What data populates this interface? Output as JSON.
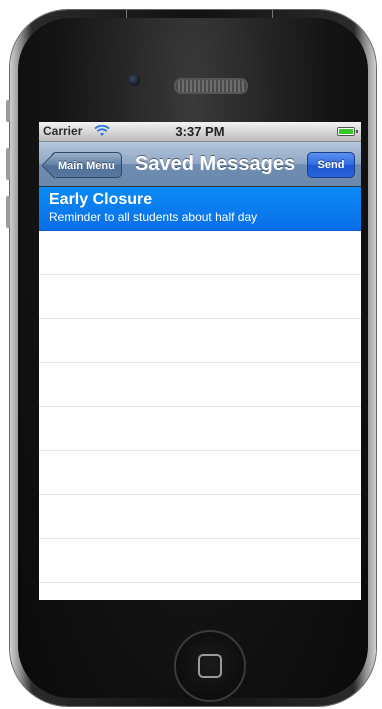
{
  "status_bar": {
    "carrier": "Carrier",
    "time": "3:37 PM",
    "wifi_icon": "wifi-icon",
    "battery_icon": "battery-icon",
    "battery_color": "#38c724"
  },
  "nav_bar": {
    "back_label": "Main Menu",
    "title": "Saved Messages",
    "send_label": "Send"
  },
  "messages": [
    {
      "title": "Early Closure",
      "subtitle": "Reminder to all students about half day",
      "selected": true
    }
  ],
  "colors": {
    "selection": "#0a7cf0",
    "nav_bar": "#7e98ba",
    "send_button": "#2a63d9"
  }
}
